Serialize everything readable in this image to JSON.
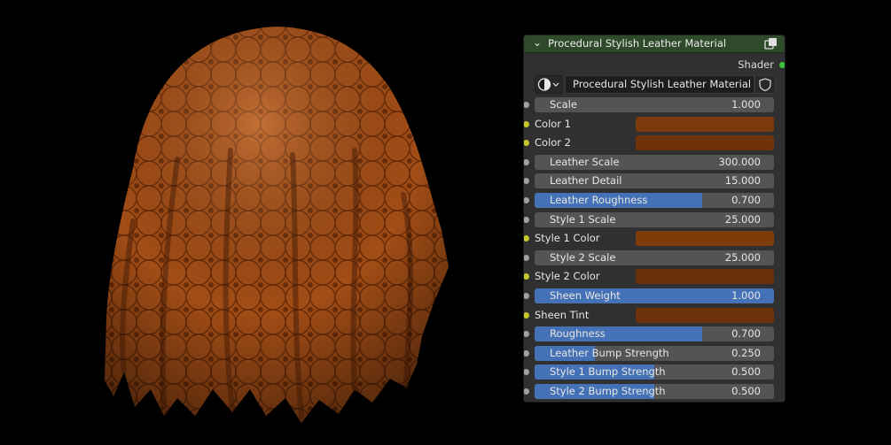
{
  "node": {
    "title": "Procedural Stylish Leather Material",
    "output_label": "Shader",
    "group_name": "Procedural Stylish Leather Material",
    "header_color": "#2e4a2a",
    "accent_color": "#4572b6",
    "icons": [
      "chevron-down-icon",
      "node-group-icon",
      "material-ball-icon",
      "fake-user-shield-icon"
    ],
    "inputs": [
      {
        "label": "Scale",
        "type": "value",
        "value": "1.000",
        "slider": false
      },
      {
        "label": "Color 1",
        "type": "color",
        "color": "#7a3a0c"
      },
      {
        "label": "Color 2",
        "type": "color",
        "color": "#6f3309"
      },
      {
        "label": "Leather Scale",
        "type": "value",
        "value": "300.000",
        "slider": false
      },
      {
        "label": "Leather Detail",
        "type": "value",
        "value": "15.000",
        "slider": false
      },
      {
        "label": "Leather Roughness",
        "type": "value",
        "value": "0.700",
        "slider": true,
        "fraction": 0.7
      },
      {
        "label": "Style 1 Scale",
        "type": "value",
        "value": "25.000",
        "slider": false
      },
      {
        "label": "Style 1 Color",
        "type": "color",
        "color": "#7d3c0a"
      },
      {
        "label": "Style 2 Scale",
        "type": "value",
        "value": "25.000",
        "slider": false
      },
      {
        "label": "Style 2 Color",
        "type": "color",
        "color": "#6a3008"
      },
      {
        "label": "Sheen Weight",
        "type": "value",
        "value": "1.000",
        "slider": true,
        "fraction": 1.0
      },
      {
        "label": "Sheen Tint",
        "type": "color",
        "color": "#6c3209"
      },
      {
        "label": "Roughness",
        "type": "value",
        "value": "0.700",
        "slider": true,
        "fraction": 0.7
      },
      {
        "label": "Leather Bump Strength",
        "type": "value",
        "value": "0.250",
        "slider": true,
        "fraction": 0.25
      },
      {
        "label": "Style 1 Bump Strength",
        "type": "value",
        "value": "0.500",
        "slider": true,
        "fraction": 0.5
      },
      {
        "label": "Style 2 Bump Strength",
        "type": "value",
        "value": "0.500",
        "slider": true,
        "fraction": 0.5
      }
    ]
  }
}
